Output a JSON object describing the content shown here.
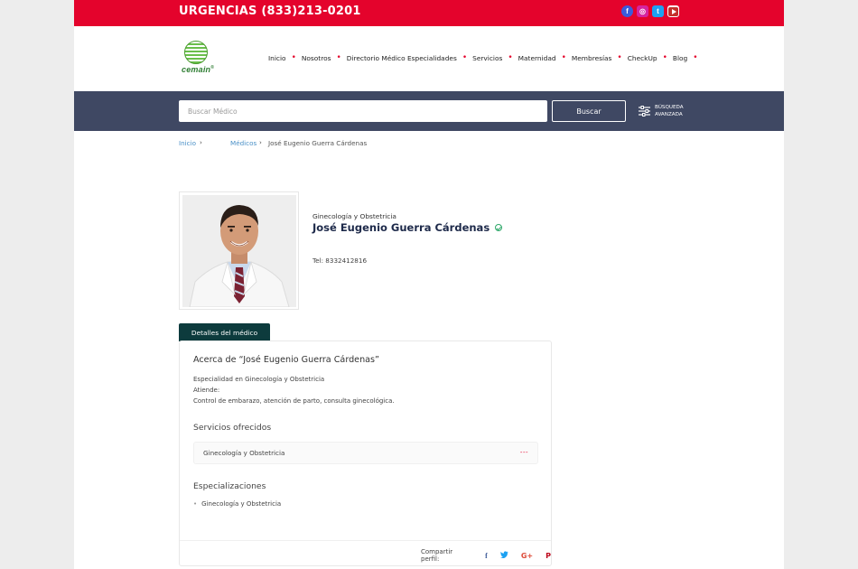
{
  "topbar": {
    "urgent": "URGENCIAS (833)213-0201",
    "socials": [
      {
        "icon": "facebook-icon",
        "glyph": "f"
      },
      {
        "icon": "instagram-icon",
        "glyph": "◎"
      },
      {
        "icon": "twitter-icon",
        "glyph": "t"
      },
      {
        "icon": "youtube-icon",
        "glyph": ""
      }
    ]
  },
  "logo": {
    "text": "cemain",
    "mark": "®"
  },
  "nav": {
    "items": [
      "Inicio",
      "Nosotros",
      "Directorio Médico Especialidades",
      "Servicios",
      "Maternidad",
      "Membresías",
      "CheckUp",
      "Blog"
    ]
  },
  "search": {
    "placeholder": "Buscar Médico",
    "button": "Buscar",
    "advanced_line1": "BÚSQUEDA",
    "advanced_line2": "AVANZADA"
  },
  "breadcrumb": {
    "home": "Inicio",
    "sep": "›",
    "section": "Médicos",
    "current": "José Eugenio Guerra Cárdenas"
  },
  "doctor": {
    "specialty": "Ginecología y Obstetricia",
    "name": "José Eugenio Guerra Cárdenas",
    "phone": "Tel: 8332412816"
  },
  "details": {
    "tab": "Detalles del médico",
    "about_title": "Acerca de “José Eugenio Guerra Cárdenas”",
    "about_lines": [
      "Especialidad en Ginecología y Obstetricia",
      "Atiende:",
      "Control de embarazo, atención de parto, consulta ginecológica."
    ],
    "services_title": "Servicios ofrecidos",
    "services": [
      "Ginecología y Obstetricia"
    ],
    "service_more": "---",
    "specializations_title": "Especializaciones",
    "specializations": [
      "Ginecología y Obstetricia"
    ],
    "share_label": "Compartir perfil:",
    "share_icons": [
      {
        "icon": "facebook-icon",
        "glyph": "f"
      },
      {
        "icon": "twitter-icon",
        "glyph": "🐦"
      },
      {
        "icon": "google-plus-icon",
        "glyph": "G+"
      },
      {
        "icon": "pinterest-icon",
        "glyph": "P"
      }
    ]
  },
  "colors": {
    "brand_red": "#e4032c",
    "band": "#3f4863",
    "tab": "#0d3b3d",
    "name": "#1e2a4a",
    "verified": "#2fa86a"
  }
}
